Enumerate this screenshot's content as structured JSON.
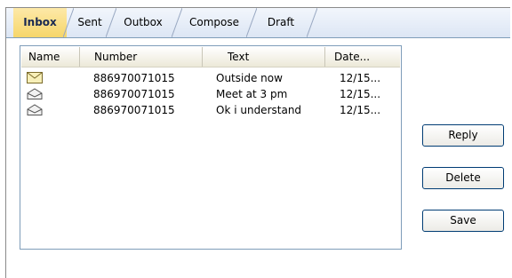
{
  "tabs": [
    {
      "label": "Inbox",
      "active": true
    },
    {
      "label": "Sent",
      "active": false
    },
    {
      "label": "Outbox",
      "active": false
    },
    {
      "label": "Compose",
      "active": false
    },
    {
      "label": "Draft",
      "active": false
    }
  ],
  "list": {
    "columns": [
      "Name",
      "Number",
      "Text",
      "Date..."
    ],
    "rows": [
      {
        "icon": "envelope-closed-icon",
        "number": "886970071015",
        "text": "Outside now",
        "date": "12/15..."
      },
      {
        "icon": "envelope-open-icon",
        "number": "886970071015",
        "text": "Meet at 3 pm",
        "date": "12/15..."
      },
      {
        "icon": "envelope-open-icon",
        "number": "886970071015",
        "text": "Ok i understand",
        "date": "12/15..."
      }
    ]
  },
  "buttons": {
    "reply": "Reply",
    "delete": "Delete",
    "save": "Save"
  }
}
